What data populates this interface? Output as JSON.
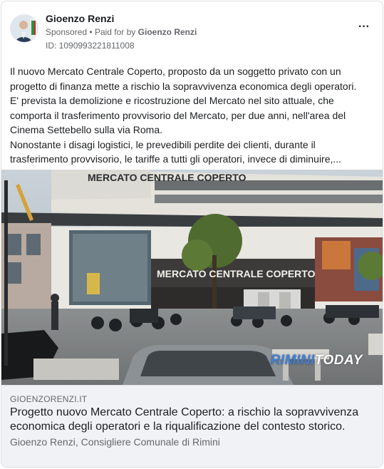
{
  "post": {
    "page_name": "Gioenzo Renzi",
    "sponsored_label": "Sponsored",
    "separator": "•",
    "paid_for_prefix": "Paid for by",
    "paid_for_name": "Gioenzo Renzi",
    "ad_id": "ID: 1090993221811008",
    "more_options": "···",
    "body_lines": [
      "Il nuovo Mercato Centrale Coperto, proposto da un soggetto privato con un progetto di finanza mette a rischio la sopravvivenza economica degli operatori.",
      "E' prevista la demolizione e ricostruzione del Mercato nel sito attuale, che comporta il trasferimento provvisorio del Mercato, per due anni, nell'area del Cinema Settebello sulla via Roma.",
      "Nonostante i disagi logistici, le prevedibili perdite dei clienti, durante il trasferimento provvisorio, le tariffe a tutti gli operatori, invece di diminuire,..."
    ]
  },
  "media": {
    "sign_top": "MERCATO CENTRALE COPERTO",
    "sign_facade": "MERCATO CENTRALE COPERTO",
    "watermark_brand": "RIMINI",
    "watermark_suffix": "TODAY"
  },
  "link": {
    "domain": "GIOENZORENZI.IT",
    "title": "Progetto nuovo Mercato Centrale Coperto: a rischio la sopravvivenza economica degli operatori e la riqualificazione del contesto storico.",
    "description": "Gioenzo Renzi, Consigliere Comunale di Rimini"
  }
}
